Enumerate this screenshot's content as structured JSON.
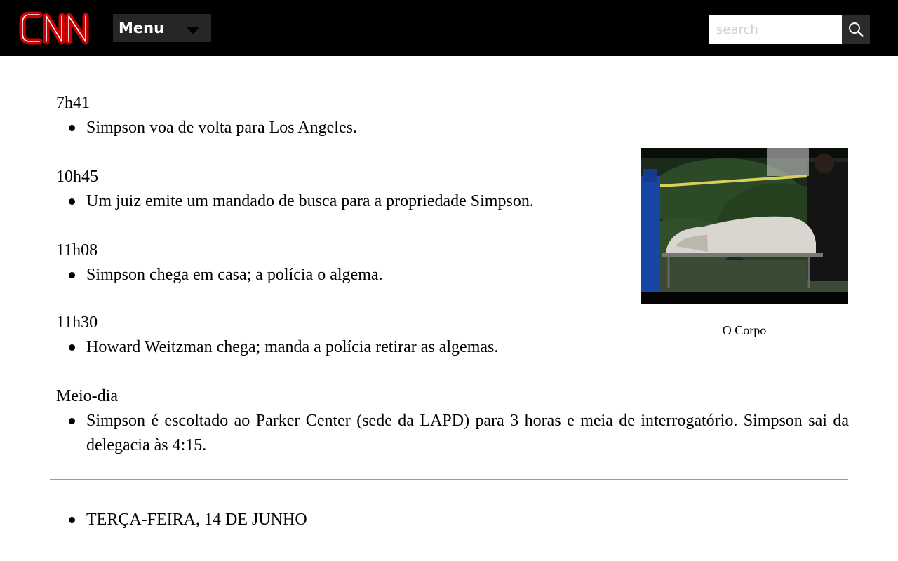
{
  "header": {
    "logo": "CNN",
    "menu_label": "Menu",
    "search_placeholder": "search",
    "search_value": ""
  },
  "timeline": [
    {
      "time": "7h41",
      "event": "Simpson voa de volta para Los Angeles."
    },
    {
      "time": "10h45",
      "event": "Um juiz emite um mandado de busca para a propriedade Simpson."
    },
    {
      "time": "11h08",
      "event": "Simpson chega em casa; a polícia o algema."
    },
    {
      "time": "11h30",
      "event": "Howard Weitzman chega; manda a polícia retirar as algemas."
    },
    {
      "time": "Meio-dia",
      "event": "Simpson é escoltado ao Parker Center (sede da LAPD) para 3 horas e meia de interrogatório. Simpson sai da delegacia às 4:15."
    }
  ],
  "figure": {
    "caption": "O Corpo"
  },
  "next_day": "TERÇA-FEIRA, 14 DE JUNHO",
  "colors": {
    "header_bg": "#000000",
    "logo_red": "#cc0000",
    "menu_bg": "#262626",
    "search_btn_bg": "#2b2b2b",
    "divider": "#9a9a9a"
  },
  "icons": {
    "logo": "cnn-logo-icon",
    "menu_caret": "caret-down-icon",
    "search": "magnifier-icon"
  }
}
